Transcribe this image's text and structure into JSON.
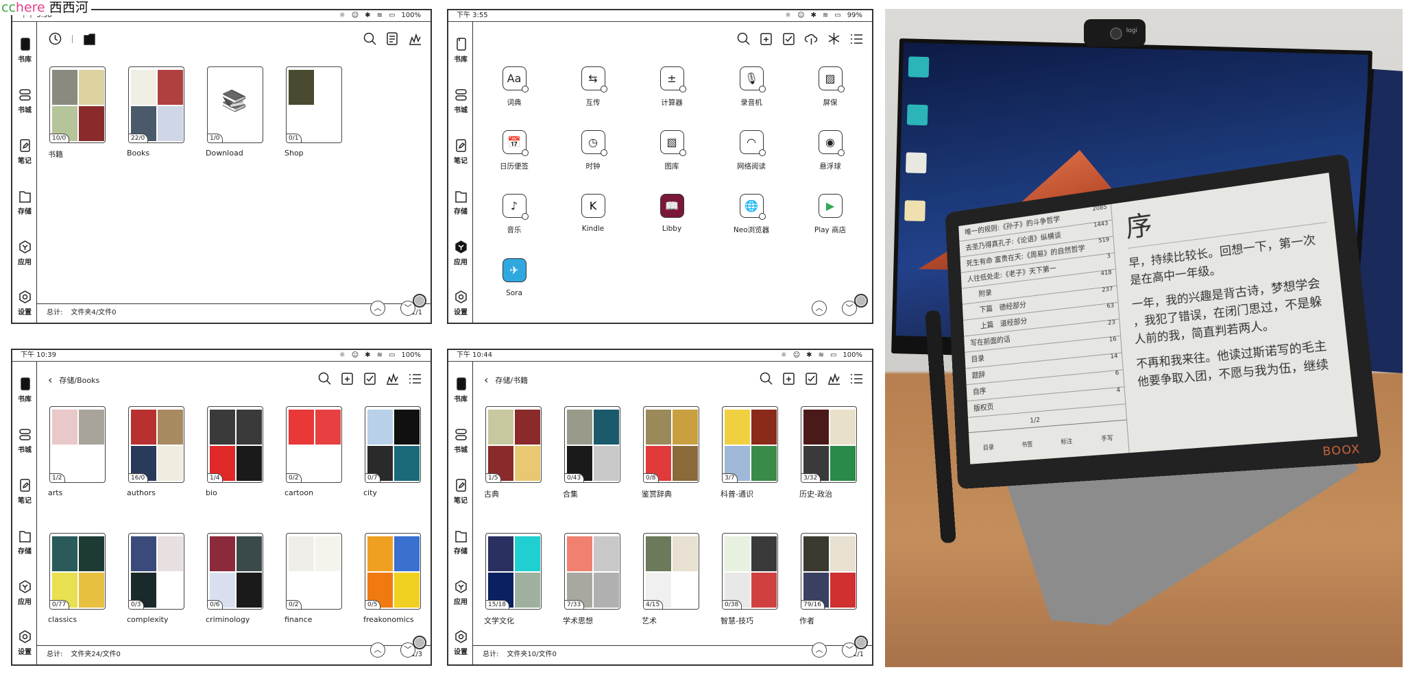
{
  "watermark": {
    "part1": "cc",
    "part2": "here",
    "part3": "西西河"
  },
  "sidebar_labels": [
    "书库",
    "书城",
    "笔记",
    "存储",
    "应用",
    "设置"
  ],
  "panels": {
    "library": {
      "status": {
        "time": "下午 3:38",
        "battery": "100%"
      },
      "active_sidebar": 0,
      "toolbar_icons": [
        "search-icon",
        "list-view-icon",
        "stats-icon"
      ],
      "tiles": [
        {
          "label": "书籍",
          "badge": "10/0",
          "colors": [
            "#8a8a80",
            "#ddd3a0",
            "#b6c49a",
            "#8a2a2a"
          ]
        },
        {
          "label": "Books",
          "badge": "22/0",
          "colors": [
            "#f1eee6",
            "#b04040",
            "#4a5a6a",
            "#cfd6e6"
          ]
        },
        {
          "label": "Download",
          "badge": "1/0",
          "colors": [],
          "placeholder_icon": "bookshelf-icon"
        },
        {
          "label": "Shop",
          "badge": "0/1",
          "colors": [
            "#4a4a30"
          ]
        }
      ],
      "footer": {
        "total_label": "总计:",
        "summary": "文件夹4/文件0",
        "page": "1/1"
      }
    },
    "apps": {
      "status": {
        "time": "下午 3:55",
        "battery": "99%"
      },
      "active_sidebar": 4,
      "toolbar_icons": [
        "search-icon",
        "add-folder-icon",
        "select-icon",
        "cloud-icon",
        "freeze-icon",
        "menu-icon"
      ],
      "apps": [
        {
          "label": "词典",
          "glyph": "Aa",
          "icon": "dictionary-icon"
        },
        {
          "label": "互传",
          "glyph": "⇆",
          "icon": "transfer-icon"
        },
        {
          "label": "计算器",
          "glyph": "±",
          "icon": "calculator-icon"
        },
        {
          "label": "录音机",
          "glyph": "🎙",
          "icon": "microphone-icon"
        },
        {
          "label": "屏保",
          "glyph": "▨",
          "icon": "screensaver-icon"
        },
        {
          "label": "日历便签",
          "glyph": "📅",
          "icon": "calendar-icon"
        },
        {
          "label": "时钟",
          "glyph": "◷",
          "icon": "clock-icon"
        },
        {
          "label": "图库",
          "glyph": "▧",
          "icon": "gallery-icon"
        },
        {
          "label": "网络阅读",
          "glyph": "◠",
          "icon": "rss-icon"
        },
        {
          "label": "悬浮球",
          "glyph": "◉",
          "icon": "floating-ball-icon"
        },
        {
          "label": "音乐",
          "glyph": "♪",
          "icon": "music-icon"
        },
        {
          "label": "Kindle",
          "glyph": "K",
          "icon": "kindle-icon",
          "bg": "#ffffff",
          "fg": "#000000"
        },
        {
          "label": "Libby",
          "glyph": "📖",
          "icon": "libby-icon",
          "bg": "#7a1838",
          "fg": "#3cc7c0"
        },
        {
          "label": "Neo浏览器",
          "glyph": "🌐",
          "icon": "globe-icon"
        },
        {
          "label": "Play 商店",
          "glyph": "▶",
          "icon": "play-store-icon",
          "fg": "#34a853"
        },
        {
          "label": "Sora",
          "glyph": "✈",
          "icon": "sora-icon",
          "bg": "#2fa8e0",
          "fg": "#ffffff"
        }
      ]
    },
    "books_folder": {
      "status": {
        "time": "下午 10:39",
        "battery": "100%"
      },
      "active_sidebar": 0,
      "breadcrumb": "存储/Books",
      "toolbar_icons": [
        "search-icon",
        "add-folder-icon",
        "select-icon",
        "stats-icon",
        "menu-icon"
      ],
      "tiles": [
        {
          "label": "arts",
          "badge": "1/2",
          "colors": [
            "#e8c8c8",
            "#a8a49a"
          ]
        },
        {
          "label": "authors",
          "badge": "16/0",
          "colors": [
            "#b83030",
            "#a88a60",
            "#2a3a5a",
            "#f0ece0"
          ]
        },
        {
          "label": "bio",
          "badge": "1/4",
          "colors": [
            "#3a3a3a",
            "#3a3a3a",
            "#e02828",
            "#1a1a1a"
          ]
        },
        {
          "label": "cartoon",
          "badge": "0/2",
          "colors": [
            "#e83838",
            "#e84040"
          ]
        },
        {
          "label": "city",
          "badge": "0/7",
          "colors": [
            "#b8d0e8",
            "#101010",
            "#2a2a2a",
            "#1a6a7a"
          ]
        },
        {
          "label": "classics",
          "badge": "0/77",
          "colors": [
            "#2a5a5a",
            "#1e3a34",
            "#e8e050",
            "#e8c040"
          ]
        },
        {
          "label": "complexity",
          "badge": "0/3",
          "colors": [
            "#3a4a7a",
            "#e8e0e0",
            "#1a2a2a"
          ]
        },
        {
          "label": "criminology",
          "badge": "0/6",
          "colors": [
            "#8a2a3a",
            "#3a4a4a",
            "#d8e0f0",
            "#1a1a1a"
          ]
        },
        {
          "label": "finance",
          "badge": "0/2",
          "colors": [
            "#f0eee8",
            "#f4f4ec"
          ]
        },
        {
          "label": "freakonomics",
          "badge": "0/5",
          "colors": [
            "#f0a020",
            "#3a70d0",
            "#f07a10",
            "#f0d020"
          ]
        }
      ],
      "footer": {
        "total_label": "总计:",
        "summary": "文件夹24/文件0",
        "page": "1/3"
      }
    },
    "shuji_folder": {
      "status": {
        "time": "下午 10:44",
        "battery": "100%"
      },
      "active_sidebar": 0,
      "breadcrumb": "存储/书籍",
      "toolbar_icons": [
        "search-icon",
        "add-folder-icon",
        "select-icon",
        "stats-icon",
        "menu-icon"
      ],
      "tiles": [
        {
          "label": "古典",
          "badge": "1/5",
          "colors": [
            "#c8c8a0",
            "#8a2a2a",
            "#8a2a2a",
            "#e8c870"
          ]
        },
        {
          "label": "合集",
          "badge": "0/43",
          "colors": [
            "#9a9a8a",
            "#1a5a6a",
            "#1a1a1a",
            "#c8c8c8"
          ]
        },
        {
          "label": "鉴赏辞典",
          "badge": "0/8",
          "colors": [
            "#9a8a5a",
            "#c8a040",
            "#e03a3a",
            "#8a6a3a"
          ]
        },
        {
          "label": "科普-通识",
          "badge": "3/7",
          "colors": [
            "#f0d040",
            "#8a2a1a",
            "#a0b8d8",
            "#3a8a4a"
          ]
        },
        {
          "label": "历史-政治",
          "badge": "3/32",
          "colors": [
            "#4a1a1a",
            "#e8e0c8",
            "#3a3a3a",
            "#2a8a4a"
          ]
        },
        {
          "label": "文学文化",
          "badge": "15/18",
          "colors": [
            "#2a3060",
            "#20d0d0",
            "#0a2060",
            "#a0b0a0"
          ]
        },
        {
          "label": "学术思想",
          "badge": "7/33",
          "colors": [
            "#f08070",
            "#c8c8c8",
            "#a8a8a0",
            "#b0b0b0"
          ]
        },
        {
          "label": "艺术",
          "badge": "4/15",
          "colors": [
            "#6a7a5a",
            "#e8e0d0",
            "#f0f0f0"
          ]
        },
        {
          "label": "智慧-技巧",
          "badge": "0/38",
          "colors": [
            "#e8f0e0",
            "#3a3a3a",
            "#e8e8e8",
            "#d04040"
          ]
        },
        {
          "label": "作者",
          "badge": "79/16",
          "colors": [
            "#3a3a30",
            "#e8e0d0",
            "#3a4060",
            "#d03030"
          ]
        }
      ],
      "footer": {
        "total_label": "总计:",
        "summary": "文件夹10/文件0",
        "page": "1/1"
      }
    }
  },
  "photo": {
    "toc": [
      {
        "title": "唯一的规则:《孙子》的斗争哲学",
        "page": "2085"
      },
      {
        "title": "去圣乃得真孔子:《论语》纵横谈",
        "page": "1443"
      },
      {
        "title": "死生有命 富贵在天:《周易》的自然哲学",
        "page": "519"
      },
      {
        "title": "人往低处走:《老子》天下第一",
        "page": "3"
      },
      {
        "title": "附录",
        "page": "418"
      },
      {
        "title": "下篇　德经部分",
        "page": "237"
      },
      {
        "title": "上篇　道经部分",
        "page": "63"
      },
      {
        "title": "写在前面的话",
        "page": "23"
      },
      {
        "title": "目录",
        "page": "16"
      },
      {
        "title": "题辞",
        "page": "14"
      },
      {
        "title": "自序",
        "page": "6"
      },
      {
        "title": "版权页",
        "page": "4"
      }
    ],
    "toc_page": "1/2",
    "toc_tabs": [
      "目录",
      "书签",
      "标注",
      "手写"
    ],
    "reader_title": "序",
    "reader_lines": [
      "早，持续比较长。回想一下，第一次",
      "是在高中一年级。",
      "一年，我的兴趣是背古诗，梦想学会",
      "，我犯了错误，在闭门思过，不是躲",
      "人前的我，简直判若两人。",
      "不再和我来往。他读过斯诺写的毛主",
      "他要争取入团，不愿与我为伍，继续"
    ],
    "brand": "BOOX",
    "webcam_brand": "logi"
  }
}
